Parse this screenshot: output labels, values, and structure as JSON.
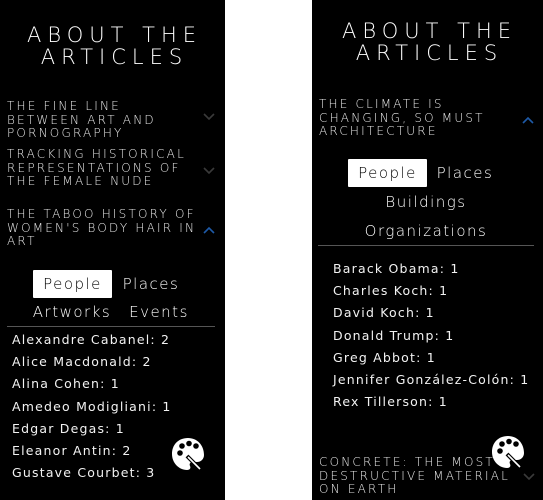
{
  "left_panel": {
    "title": "About the Articles",
    "articles": [
      {
        "title": "The Fine Line Between Art and Pornography",
        "expanded": false
      },
      {
        "title": "Tracking Historical Representations of the Female Nude",
        "expanded": false
      },
      {
        "title": "The Taboo History of Women's Body Hair in Art",
        "expanded": true
      }
    ],
    "tabs": [
      "People",
      "Places",
      "Artworks",
      "Events"
    ],
    "active_tab": "People",
    "people": [
      "Alexandre Cabanel: 2",
      "Alice Macdonald: 2",
      "Alina Cohen: 1",
      "Amedeo Modigliani: 1",
      "Edgar Degas: 1",
      "Eleanor Antin: 2",
      "Gustave Courbet: 3"
    ]
  },
  "right_panel": {
    "title": "About the Articles",
    "articles": [
      {
        "title": "The Climate is Changing, So Must Architecture",
        "expanded": true
      },
      {
        "title": "Concrete: The Most Destructive Material on Earth",
        "expanded": false
      }
    ],
    "tabs": [
      "People",
      "Places",
      "Buildings",
      "Organizations"
    ],
    "active_tab": "People",
    "people": [
      "Barack Obama: 1",
      "Charles Koch: 1",
      "David Koch: 1",
      "Donald Trump: 1",
      "Greg Abbot: 1",
      "Jennifer González-Colón: 1",
      "Rex Tillerson: 1"
    ]
  },
  "colors": {
    "panel_bg": "#000000",
    "text": "#ffffff",
    "chevron_collapsed": "#3a3a3a",
    "chevron_expanded": "#1e5aa8",
    "divider": "#555555"
  },
  "icons": {
    "fab": "palette-icon",
    "chevron_down": "chevron-down-icon",
    "chevron_up": "chevron-up-icon"
  }
}
